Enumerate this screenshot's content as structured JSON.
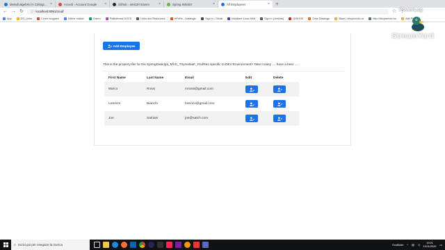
{
  "browser": {
    "tabs": [
      {
        "label": "Metodi algebrici in Crittografia",
        "color": "#1a73e8",
        "active": false
      },
      {
        "label": "Accedi - Account Google",
        "color": "#ea4335",
        "active": false
      },
      {
        "label": "Github - amit1974/amm",
        "color": "#24292e",
        "active": false
      },
      {
        "label": "Spring Initializr",
        "color": "#6db33f",
        "active": false
      },
      {
        "label": "All Employees",
        "color": "#1a73e8",
        "active": true
      }
    ],
    "url": "localhost:8091/crud/",
    "bookmarks": [
      {
        "label": "App",
        "color": "#4285f4"
      },
      {
        "label": "DS_Links",
        "color": "#f4b400"
      },
      {
        "label": "Come ricopiare",
        "color": "#db4437"
      },
      {
        "label": "Ultime notizie",
        "color": "#4285f4"
      },
      {
        "label": "Cidero",
        "color": "#0f9d58"
      },
      {
        "label": "Piattaforma DOCS",
        "color": "#ab47bc"
      },
      {
        "label": "Links and Resources",
        "color": "#455a64"
      },
      {
        "label": "HPeRe - Datalogic",
        "color": "#e65100"
      },
      {
        "label": "Sign in - Orbali",
        "color": "#424242"
      },
      {
        "label": "Installare Linux Mint",
        "color": "#5e35b1"
      },
      {
        "label": "Sign in (Jenkins)",
        "color": "#6d4c41"
      },
      {
        "label": "JASHOK",
        "color": "#c62828"
      },
      {
        "label": "Crea Datalogic",
        "color": "#ef6c00"
      },
      {
        "label": "Base | nfsoprendo.co",
        "color": "#f9a825"
      },
      {
        "label": "http://dhcpserver.loc",
        "color": "#546e7a"
      },
      {
        "label": "Altri Preferiti",
        "color": "#f9a825"
      }
    ]
  },
  "page": {
    "add_button_label": "Add Employee",
    "property_text": "This is the property file for the SpringDataJpa_MVC_ThymeleaF_ProfRes specific to DEV Environment!! Take it easy .... have a beer ....",
    "table": {
      "headers": [
        "First Name",
        "Last Name",
        "Email",
        "Edit",
        "Delete"
      ],
      "rows": [
        {
          "first": "Marco",
          "last": "Rossi",
          "email": "mrossi@gmail.com"
        },
        {
          "first": "Lorenzo",
          "last": "Bianchi",
          "email": "lorenzo@gmail.com"
        },
        {
          "first": "Joe",
          "last": "Satriani",
          "email": "joe@satch.com"
        }
      ]
    }
  },
  "watermark": {
    "tag": "PowerLog",
    "brand": "StreamYard"
  },
  "taskbar": {
    "search_placeholder": "Scrivi qui per eseguire la ricerca",
    "tray_label": "EcoMode",
    "time": "19:01",
    "date": "10/11/2020"
  },
  "colors": {
    "primary": "#1a73e8",
    "striped_row": "#f2f2f2",
    "taskbar": "#101216"
  }
}
